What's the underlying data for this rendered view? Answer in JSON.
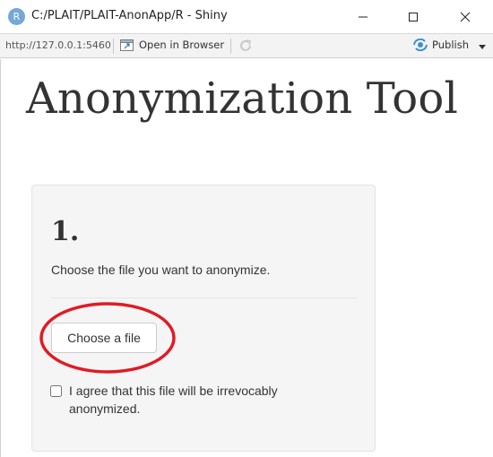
{
  "window": {
    "app_icon_letter": "R",
    "title": "C:/PLAIT/PLAIT-AnonApp/R - Shiny"
  },
  "toolbar": {
    "url": "http://127.0.0.1:5460",
    "open_in_browser": "Open in Browser",
    "publish": "Publish"
  },
  "page": {
    "title": "Anonymization Tool"
  },
  "step1": {
    "number": "1.",
    "description": "Choose the file you want to anonymize.",
    "file_button": "Choose a file",
    "agree_label": "I agree that this file will be irrevocably anonymized.",
    "agree_checked": false
  },
  "annotation": {
    "ellipse_color": "#e01b24"
  }
}
